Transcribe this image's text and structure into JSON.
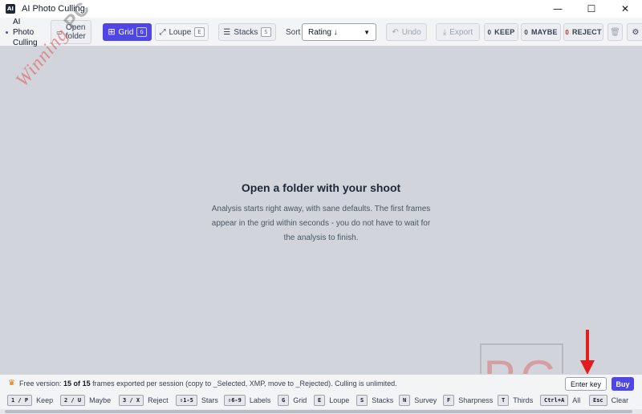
{
  "window": {
    "title": "AI Photo Culling",
    "app_icon": "AI",
    "controls": [
      "minimize-icon",
      "maximize-icon",
      "close-icon"
    ]
  },
  "toolbar": {
    "brand": [
      "AI",
      "Photo",
      "Culling"
    ],
    "open_folder": [
      "Open",
      "folder"
    ],
    "grid": {
      "label": "Grid",
      "key": "G"
    },
    "loupe": {
      "label": "Loupe",
      "key": "E"
    },
    "stacks": {
      "label": "Stacks",
      "key": "S"
    },
    "sort_label": "Sort",
    "sort_value": "Rating ↓",
    "undo": "Undo",
    "export": "Export",
    "keep": {
      "num": "0",
      "label": "KEEP"
    },
    "maybe": {
      "num": "0",
      "label": "MAYBE"
    },
    "reject": {
      "num": "0",
      "label": "REJECT"
    }
  },
  "main": {
    "title": "Open a folder with your shoot",
    "description": "Analysis starts right away, with sane defaults. The first frames appear in the grid within seconds - you do not have to wait for the analysis to finish."
  },
  "watermark": {
    "script": "Winning",
    "mark": "PC",
    "box": "PC"
  },
  "infobar": {
    "prefix": "Free version:",
    "count": "15",
    "of": "of",
    "total": "15",
    "suffix": "frames exported per session (copy to _Selected, XMP, move to _Rejected). Culling is unlimited.",
    "enter_key": "Enter key",
    "buy": "Buy"
  },
  "shortcuts": [
    {
      "key": "1 / P",
      "label": "Keep"
    },
    {
      "key": "2 / U",
      "label": "Maybe"
    },
    {
      "key": "3 / X",
      "label": "Reject"
    },
    {
      "key": "⇧1-5",
      "label": "Stars"
    },
    {
      "key": "⇧6-9",
      "label": "Labels"
    },
    {
      "key": "G",
      "label": "Grid"
    },
    {
      "key": "E",
      "label": "Loupe"
    },
    {
      "key": "S",
      "label": "Stacks"
    },
    {
      "key": "N",
      "label": "Survey"
    },
    {
      "key": "F",
      "label": "Sharpness"
    },
    {
      "key": "T",
      "label": "Thirds"
    },
    {
      "key": "Ctrl+A",
      "label": "All"
    },
    {
      "key": "Esc",
      "label": "Clear"
    }
  ],
  "colors": {
    "accent": "#4f46e5",
    "canvas": "#d1d5db",
    "arrow": "#e11d1d"
  }
}
